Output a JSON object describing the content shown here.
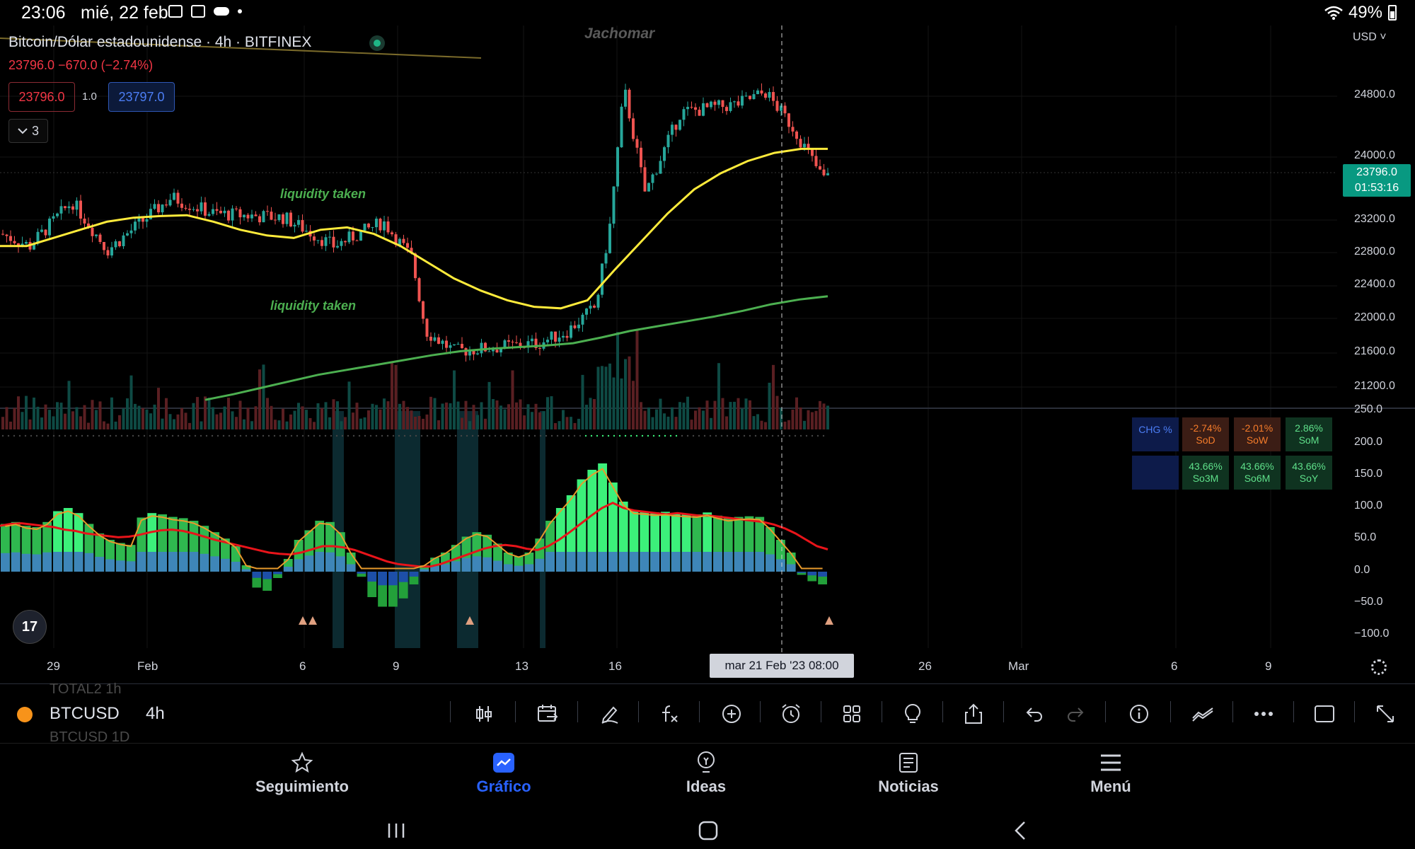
{
  "status_bar": {
    "time": "23:06",
    "date": "mié, 22 feb",
    "battery": "49%"
  },
  "chart": {
    "legend": {
      "title": "Bitcoin/Dólar estadounidense · 4h · BITFINEX",
      "change": "23796.0  −670.0 (−2.74%)",
      "bid": "23796.0",
      "spread": "1.0",
      "ask": "23797.0",
      "indicators_count": "3"
    },
    "watermark": "Jachomar",
    "labels": [
      "liquidity taken",
      "liquidity taken"
    ],
    "currency": "USD",
    "last_price": {
      "price": "23796.0",
      "countdown": "01:53:16"
    },
    "crosshair_time": "mar 21 Feb '23   08:00",
    "chg_table": {
      "header": "CHG %",
      "cells": [
        {
          "value": "-2.74%",
          "label": "SoD"
        },
        {
          "value": "-2.01%",
          "label": "SoW"
        },
        {
          "value": "2.86%",
          "label": "SoM"
        },
        {
          "value": "43.66%",
          "label": "So3M"
        },
        {
          "value": "43.66%",
          "label": "So6M"
        },
        {
          "value": "43.66%",
          "label": "SoY"
        }
      ]
    }
  },
  "chart_data": [
    {
      "type": "line",
      "title": "Bitcoin/Dólar estadounidense · 4h · BITFINEX",
      "x_ticks": [
        "29",
        "Feb",
        "6",
        "9",
        "13",
        "16",
        "26",
        "Mar",
        "6",
        "9"
      ],
      "y_ticks": [
        "24800.0",
        "24000.0",
        "23200.0",
        "22800.0",
        "22400.0",
        "22000.0",
        "21600.0",
        "21200.0"
      ],
      "series": [
        {
          "values": [
            22950,
            22950,
            23050,
            23150,
            23250,
            23300,
            23320,
            23330,
            23250,
            23150,
            23080,
            23050,
            23150,
            23180,
            23100,
            22950,
            22750,
            22550,
            22400,
            22280,
            22200,
            22180,
            22280,
            22650,
            23000,
            23350,
            23650,
            23850,
            24000,
            24100,
            24150,
            24150
          ]
        },
        {
          "values": [
            21050,
            21120,
            21200,
            21280,
            21360,
            21420,
            21480,
            21540,
            21600,
            21650,
            21680,
            21700,
            21720,
            21750,
            21820,
            21900,
            21960,
            22020,
            22080,
            22150,
            22230,
            22290,
            22330
          ]
        }
      ],
      "ylim": [
        21100,
        25000
      ]
    },
    {
      "type": "bar",
      "y_ticks": [
        "250.0",
        "200.0",
        "150.0",
        "100.0",
        "50.0",
        "0.0",
        "−50.0",
        "−100.0"
      ],
      "series": [
        {
          "values": [
            75,
            78,
            72,
            70,
            78,
            95,
            100,
            92,
            75,
            60,
            50,
            45,
            42,
            85,
            92,
            90,
            86,
            84,
            80,
            72,
            62,
            52,
            40,
            10,
            -25,
            -30,
            -10,
            20,
            50,
            65,
            80,
            78,
            62,
            30,
            -8,
            -40,
            -55,
            -55,
            -42,
            -20,
            10,
            22,
            30,
            42,
            55,
            62,
            58,
            44,
            30,
            24,
            30,
            52,
            80,
            100,
            120,
            145,
            160,
            170,
            140,
            110,
            96,
            95,
            93,
            94,
            92,
            91,
            90,
            93,
            88,
            84,
            86,
            87,
            86,
            70,
            50,
            30,
            -5,
            -15,
            -20
          ]
        },
        {
          "values": [
            72,
            75,
            76,
            74,
            72,
            70,
            66,
            64,
            60,
            58,
            56,
            54,
            55,
            58,
            62,
            65,
            66,
            64,
            60,
            55,
            50,
            46,
            42,
            38,
            34,
            30,
            28,
            27,
            30,
            35,
            40,
            40,
            38,
            34,
            28,
            22,
            16,
            12,
            10,
            8,
            8,
            12,
            18,
            24,
            30,
            36,
            40,
            42,
            40,
            36,
            34,
            40,
            50,
            62,
            75,
            88,
            100,
            108,
            100,
            96,
            94,
            92,
            90,
            92,
            90,
            88,
            88,
            86,
            84,
            82,
            80,
            78,
            74,
            68,
            60,
            50,
            40,
            35
          ]
        }
      ],
      "ylim": [
        -125,
        255
      ]
    }
  ],
  "toolbar": {
    "symbol": "BTCUSD",
    "timeframe": "4h",
    "ghost_above": "TOTAL2   1h",
    "ghost_below": "BTCUSD   1D"
  },
  "nav": {
    "items": [
      {
        "label": "Seguimiento"
      },
      {
        "label": "Gráfico"
      },
      {
        "label": "Ideas"
      },
      {
        "label": "Noticias"
      },
      {
        "label": "Menú"
      }
    ]
  },
  "colors": {
    "up": "#26a69a",
    "down": "#ef5350",
    "ema_fast": "#ffeb3b",
    "ema_slow": "#4caf50",
    "accent": "#2962ff",
    "last_price_bg": "#089981",
    "signal": "#e8141a"
  }
}
